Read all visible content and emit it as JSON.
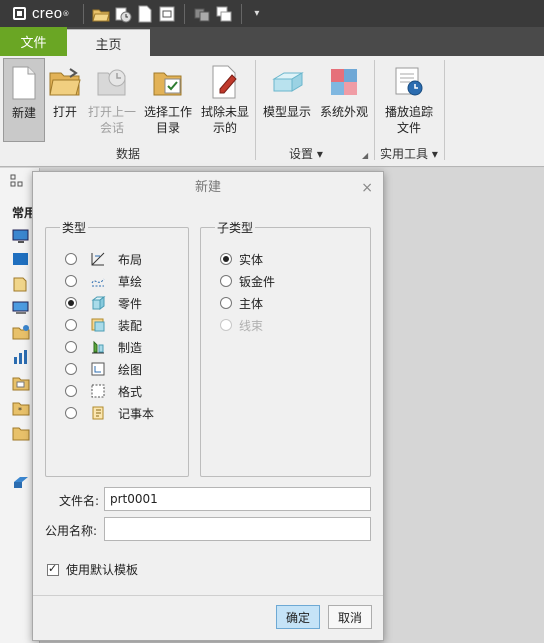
{
  "app": {
    "logo_text": "creo",
    "logo_mark": "®"
  },
  "quick_access": {
    "icons": [
      "open-folder-icon",
      "open-session-icon",
      "new-file-icon",
      "select-window-icon",
      "regenerate-icon",
      "windows-icon"
    ],
    "dropdown_glyph": "▾"
  },
  "ribbon_tabs": {
    "file": "文件",
    "home": "主页"
  },
  "ribbon": {
    "new": "新建",
    "open": "打开",
    "open_last": "打开上一\n会话",
    "select_dir": "选择工作\n目录",
    "erase": "拭除未显\n示的",
    "model_display": "模型显示",
    "system_appearance": "系统外观",
    "playback_trail": "播放追踪\n文件",
    "group_data": "数据",
    "group_settings": "设置",
    "group_utilities": "实用工具",
    "group_dropdown": "▾"
  },
  "left_panel": {
    "title": "常用"
  },
  "dialog": {
    "title": "新建",
    "close": "×",
    "type_legend": "类型",
    "subtype_legend": "子类型",
    "types": [
      {
        "label": "布局",
        "icon": "layout-icon",
        "checked": false
      },
      {
        "label": "草绘",
        "icon": "sketch-icon",
        "checked": false
      },
      {
        "label": "零件",
        "icon": "part-icon",
        "checked": true
      },
      {
        "label": "装配",
        "icon": "assembly-icon",
        "checked": false
      },
      {
        "label": "制造",
        "icon": "manufacturing-icon",
        "checked": false
      },
      {
        "label": "绘图",
        "icon": "drawing-icon",
        "checked": false
      },
      {
        "label": "格式",
        "icon": "format-icon",
        "checked": false
      },
      {
        "label": "记事本",
        "icon": "notebook-icon",
        "checked": false
      }
    ],
    "subtypes": [
      {
        "label": "实体",
        "checked": true,
        "disabled": false
      },
      {
        "label": "钣金件",
        "checked": false,
        "disabled": false
      },
      {
        "label": "主体",
        "checked": false,
        "disabled": false
      },
      {
        "label": "线束",
        "checked": false,
        "disabled": true
      }
    ],
    "filename_label": "文件名:",
    "filename_value": "prt0001",
    "common_name_label": "公用名称:",
    "common_name_value": "",
    "use_default_template_label": "使用默认模板",
    "use_default_template_checked": true,
    "ok": "确定",
    "cancel": "取消"
  }
}
